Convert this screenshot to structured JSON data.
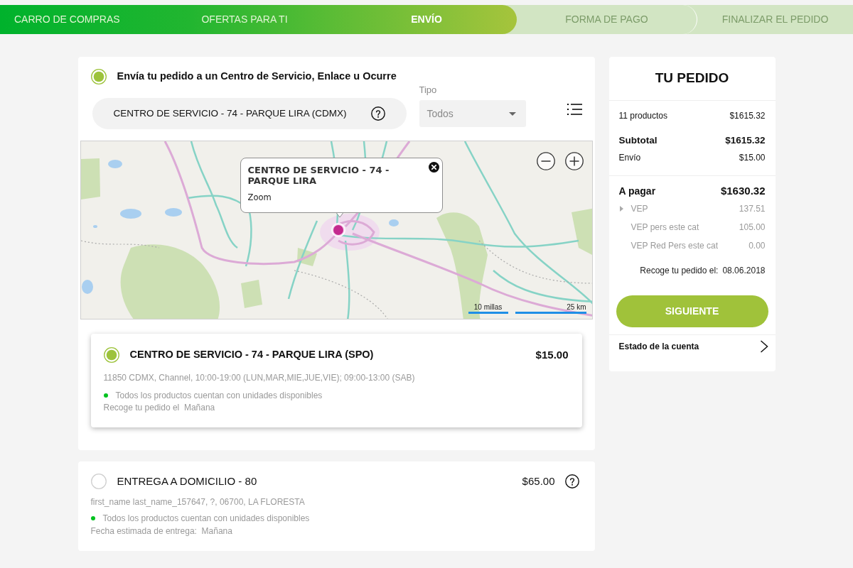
{
  "steps": [
    {
      "label": "CARRO DE COMPRAS",
      "selected": false
    },
    {
      "label": "OFERTAS PARA TI",
      "selected": false
    },
    {
      "label": "ENVÍO",
      "selected": true
    },
    {
      "label": "FORMA DE PAGO",
      "selected": false
    },
    {
      "label": "FINALIZAR EL PEDIDO",
      "selected": false
    }
  ],
  "pickup": {
    "selected": true,
    "title": "Envía tu pedido a un Centro de Servicio, Enlace u Ocurre",
    "search": {
      "value": "CENTRO DE SERVICIO - 74 - PARQUE LIRA (CDMX)"
    },
    "type_filter": {
      "label": "Tipo",
      "value": "Todos"
    },
    "map": {
      "popup": {
        "title": "CENTRO DE SERVICIO - 74 - PARQUE LIRA",
        "link": "Zoom"
      },
      "scale": [
        "10 millas",
        "25 km"
      ]
    },
    "locations": [
      {
        "selected": true,
        "name": "CENTRO DE SERVICIO - 74 - PARQUE LIRA (SPO)",
        "price": "$15.00",
        "address": "11850 CDMX, Channel, 10:00-19:00 (LUN,MAR,MIE,JUE,VIE); 09:00-13:00 (SAB)",
        "availability": "Todos los productos cuentan con unidades disponibles",
        "date": "Recoge tu pedido el  Mañana"
      }
    ]
  },
  "home_delivery": {
    "selected": false,
    "title": "ENTREGA A DOMICILIO - 80",
    "price": "$65.00",
    "address": "first_name last_name_157647, ?, 06700, LA FLORESTA",
    "availability": "Todos los productos cuentan con unidades disponibles",
    "date": "Fecha estimada de entrega:  Mañana"
  },
  "order": {
    "title": "TU PEDIDO",
    "lines": [
      {
        "kind": "item",
        "label": "11 productos",
        "value": "$1615.32"
      },
      {
        "kind": "subtotal",
        "label": "Subtotal",
        "value": "$1615.32"
      },
      {
        "kind": "item",
        "label": "Envío",
        "value": "$15.00"
      }
    ],
    "total": {
      "label": "A pagar",
      "value": "$1630.32"
    },
    "vep_rows": [
      {
        "kind": "toggle",
        "expanded": false,
        "label": "VEP",
        "value": "137.51"
      },
      {
        "kind": "plain",
        "label": "VEP pers este cat",
        "value": "105.00"
      },
      {
        "kind": "plain",
        "label": "VEP Red Pers este cat",
        "value": "0.00"
      }
    ],
    "pickup_date": {
      "label": "Recoge tu pedido el:",
      "value": "08.06.2018"
    },
    "button": "SIGUIENTE",
    "account_link": "Estado de la cuenta"
  }
}
